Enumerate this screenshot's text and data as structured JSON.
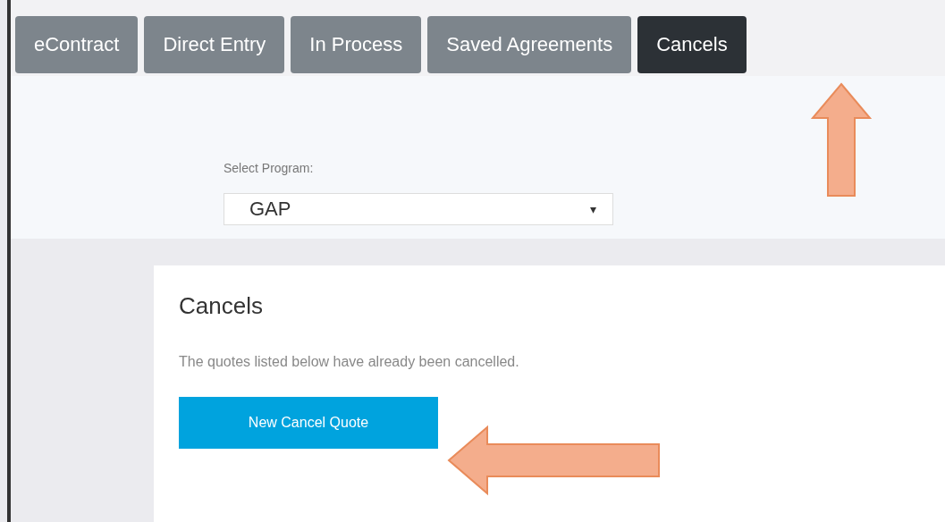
{
  "tabs": [
    {
      "label": "eContract",
      "selected": false
    },
    {
      "label": "Direct Entry",
      "selected": false
    },
    {
      "label": "In Process",
      "selected": false
    },
    {
      "label": "Saved Agreements",
      "selected": false
    },
    {
      "label": "Cancels",
      "selected": true
    }
  ],
  "program_select": {
    "label": "Select Program:",
    "value": "GAP",
    "caret": "▾"
  },
  "card": {
    "title": "Cancels",
    "message": "The quotes listed below have already been cancelled.",
    "button": "New Cancel Quote"
  }
}
